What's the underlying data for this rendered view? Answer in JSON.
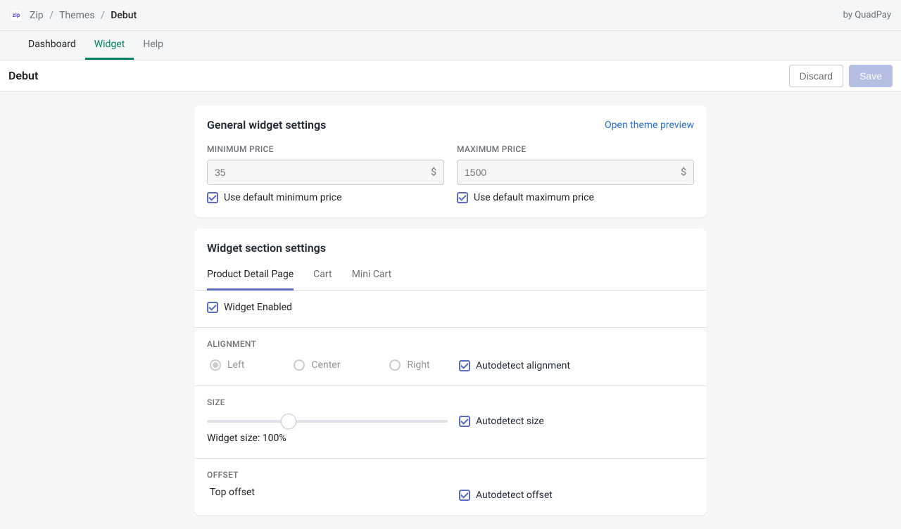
{
  "topbar": {
    "brand_glyph": "zip",
    "crumb1": "Zip",
    "crumb2": "Themes",
    "crumb3": "Debut",
    "byline": "by QuadPay"
  },
  "nav": {
    "dashboard": "Dashboard",
    "widget": "Widget",
    "help": "Help"
  },
  "page": {
    "title": "Debut",
    "discard": "Discard",
    "save": "Save"
  },
  "general": {
    "heading": "General widget settings",
    "preview_link": "Open theme preview",
    "min_label": "Minimum price",
    "max_label": "Maximum price",
    "min_placeholder": "35",
    "max_placeholder": "1500",
    "currency": "$",
    "use_default_min": "Use default minimum price",
    "use_default_max": "Use default maximum price"
  },
  "section": {
    "heading": "Widget section settings",
    "tabs": {
      "pdp": "Product Detail Page",
      "cart": "Cart",
      "mini": "Mini Cart"
    },
    "widget_enabled": "Widget Enabled",
    "alignment_label": "Alignment",
    "align_left": "Left",
    "align_center": "Center",
    "align_right": "Right",
    "auto_align": "Autodetect alignment",
    "size_label": "Size",
    "size_caption": "Widget size: 100%",
    "auto_size": "Autodetect size",
    "offset_label": "Offset",
    "top_offset": "Top offset",
    "auto_offset": "Autodetect offset"
  }
}
